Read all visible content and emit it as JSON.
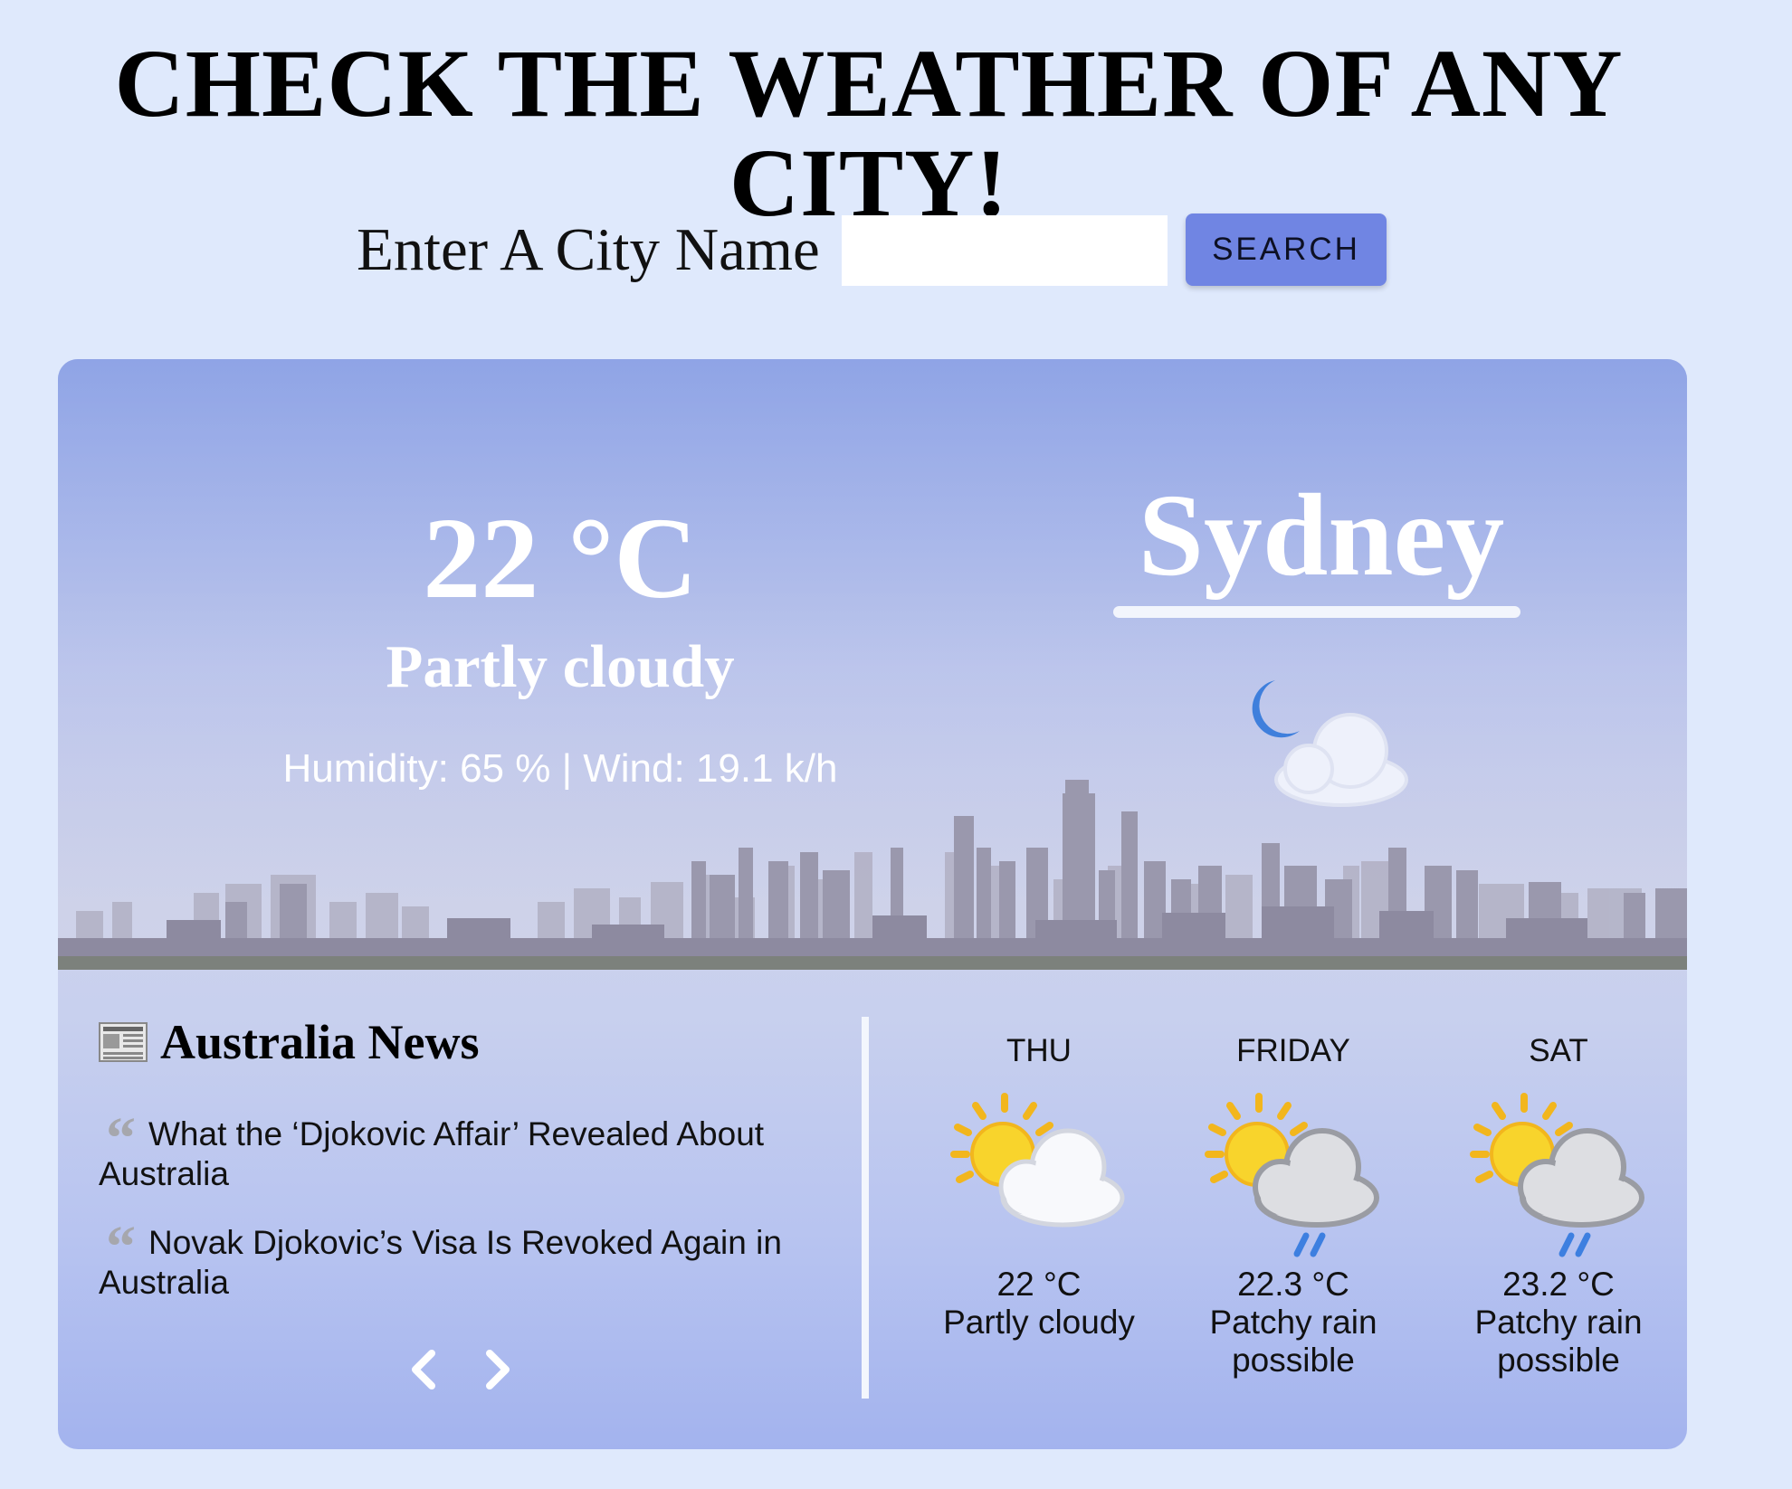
{
  "header": {
    "title": "CHECK THE WEATHER OF ANY CITY!"
  },
  "search": {
    "label": "Enter A City Name",
    "value": "",
    "placeholder": "",
    "button_label": "SEARCH"
  },
  "current": {
    "temperature": "22 °C",
    "condition": "Partly cloudy",
    "details": "Humidity: 65 % | Wind: 19.1 k/h",
    "city": "Sydney",
    "icon": "night-partly-cloudy-icon"
  },
  "news": {
    "icon": "newspaper-icon",
    "title": "Australia News",
    "items": [
      {
        "text": "What the ‘Djokovic Affair’ Revealed About Australia"
      },
      {
        "text": "Novak Djokovic’s Visa Is Revoked Again in Australia"
      }
    ],
    "prev_icon": "chevron-left-icon",
    "next_icon": "chevron-right-icon"
  },
  "forecast": [
    {
      "day": "THU",
      "temp": "22 °C",
      "condition": "Partly cloudy",
      "icon": "sun-cloud-icon"
    },
    {
      "day": "FRIDAY",
      "temp": "22.3 °C",
      "condition": "Patchy rain possible",
      "icon": "sun-rain-cloud-icon"
    },
    {
      "day": "SAT",
      "temp": "23.2 °C",
      "condition": "Patchy rain possible",
      "icon": "sun-rain-cloud-icon"
    }
  ],
  "colors": {
    "page_background": "#dfe9fc",
    "accent_button": "#7085e3",
    "card_top": "#8fa4e6",
    "card_bottom": "#a3b3ee"
  }
}
